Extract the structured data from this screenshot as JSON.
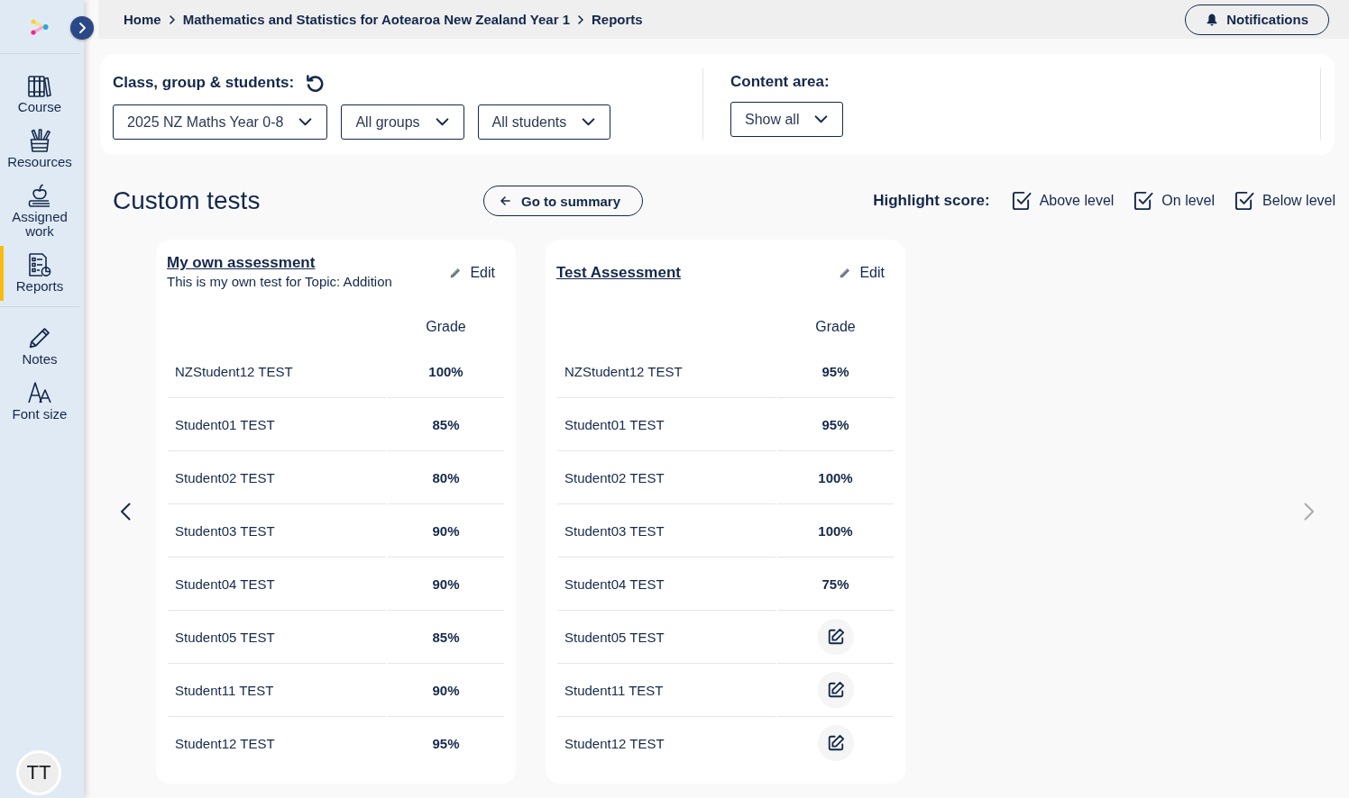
{
  "sidebar": {
    "nav_items": [
      {
        "label": "Course",
        "selected": false
      },
      {
        "label": "Resources",
        "selected": false
      },
      {
        "label": "Assigned work",
        "selected": false
      },
      {
        "label": "Reports",
        "selected": true
      }
    ],
    "tool_items": [
      {
        "label": "Notes"
      },
      {
        "label": "Font size"
      }
    ],
    "avatar": {
      "initials": "TT"
    }
  },
  "breadcrumb": [
    "Home",
    "Mathematics and Statistics for Aotearoa New Zealand Year 1",
    "Reports"
  ],
  "notifications_button": "Notifications",
  "filters": {
    "class_group_students": {
      "label": "Class, group & students:",
      "dropdowns": [
        "2025 NZ Maths Year 0-8",
        "All groups",
        "All students"
      ]
    },
    "content_area": {
      "label": "Content area:",
      "dropdown": "Show all"
    }
  },
  "heading": "Custom tests",
  "summary_button": "Go to summary",
  "highlight_score": {
    "label": "Highlight score:",
    "options": [
      {
        "label": "Above level",
        "checked": true
      },
      {
        "label": "On level",
        "checked": true
      },
      {
        "label": "Below level",
        "checked": true
      }
    ]
  },
  "carousel": {
    "prev_disabled": false,
    "next_disabled": true
  },
  "tests": [
    {
      "title": "My own assessment",
      "subtitle": "This is my own test for Topic: Addition",
      "edit_label": "Edit",
      "column_header": "Grade",
      "rows": [
        {
          "student": "NZStudent12 TEST",
          "kind": "score",
          "grade": "100%"
        },
        {
          "student": "Student01 TEST",
          "kind": "score",
          "grade": "85%"
        },
        {
          "student": "Student02 TEST",
          "kind": "score",
          "grade": "80%"
        },
        {
          "student": "Student03 TEST",
          "kind": "score",
          "grade": "90%"
        },
        {
          "student": "Student04 TEST",
          "kind": "score",
          "grade": "90%"
        },
        {
          "student": "Student05 TEST",
          "kind": "score",
          "grade": "85%"
        },
        {
          "student": "Student11 TEST",
          "kind": "score",
          "grade": "90%"
        },
        {
          "student": "Student12 TEST",
          "kind": "score",
          "grade": "95%"
        }
      ]
    },
    {
      "title": "Test Assessment",
      "edit_label": "Edit",
      "column_header": "Grade",
      "rows": [
        {
          "student": "NZStudent12 TEST",
          "kind": "score",
          "grade": "95%"
        },
        {
          "student": "Student01 TEST",
          "kind": "score",
          "grade": "95%"
        },
        {
          "student": "Student02 TEST",
          "kind": "score",
          "grade": "100%"
        },
        {
          "student": "Student03 TEST",
          "kind": "score",
          "grade": "100%"
        },
        {
          "student": "Student04 TEST",
          "kind": "score",
          "grade": "75%"
        },
        {
          "student": "Student05 TEST",
          "kind": "entry"
        },
        {
          "student": "Student11 TEST",
          "kind": "entry"
        },
        {
          "student": "Student12 TEST",
          "kind": "entry"
        }
      ]
    }
  ]
}
